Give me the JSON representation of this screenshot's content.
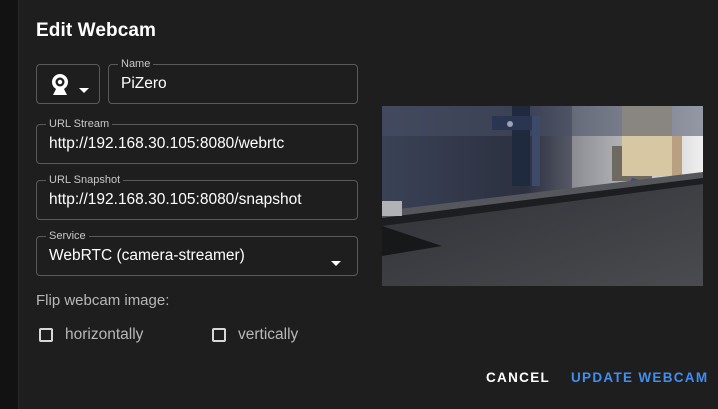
{
  "dialog": {
    "title": "Edit Webcam"
  },
  "icon_select": {
    "icon": "webcam-icon"
  },
  "fields": {
    "name": {
      "label": "Name",
      "value": "PiZero"
    },
    "url_stream": {
      "label": "URL Stream",
      "value": "http://192.168.30.105:8080/webrtc"
    },
    "url_snapshot": {
      "label": "URL Snapshot",
      "value": "http://192.168.30.105:8080/snapshot"
    },
    "service": {
      "label": "Service",
      "value": "WebRTC (camera-streamer)"
    }
  },
  "flip": {
    "label": "Flip webcam image:",
    "horizontal_label": "horizontally",
    "horizontal_checked": false,
    "vertical_label": "vertically",
    "vertical_checked": false
  },
  "actions": {
    "cancel_label": "CANCEL",
    "update_label": "UPDATE WEBCAM"
  },
  "colors": {
    "background": "#1e1e1e",
    "accent": "#3f8ef2",
    "border": "#5a5a5a"
  }
}
